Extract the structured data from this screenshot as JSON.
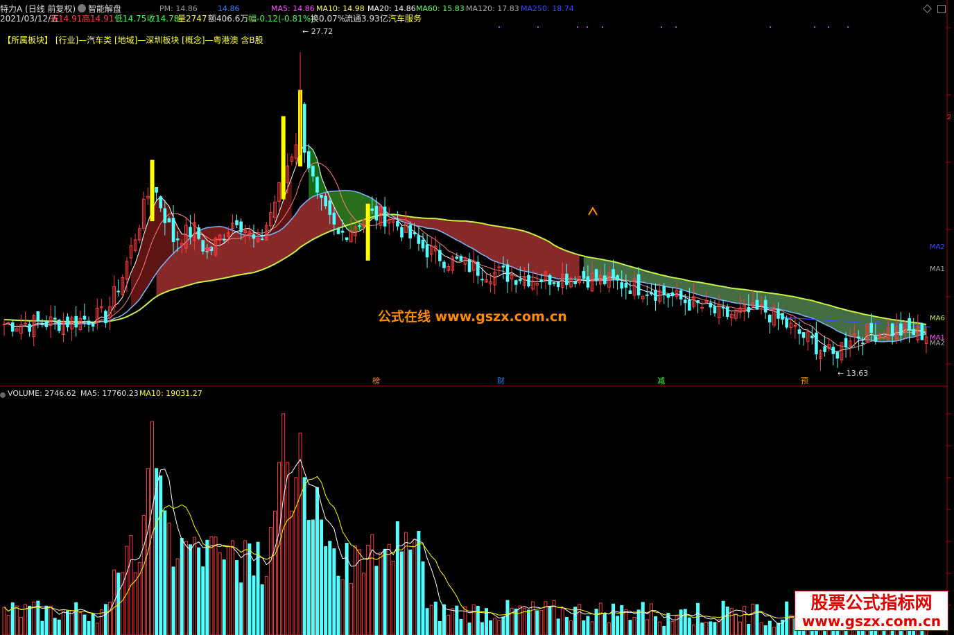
{
  "header": {
    "stock_title": "特力A (日线 前复权)",
    "mode_label": "智能解盘",
    "pm_label": "PM: 14.86",
    "pm_value": "14.86",
    "ma5": "MA5: 14.86",
    "ma10": "MA10: 14.98",
    "ma20": "MA20: 14.86",
    "ma60": "MA60: 15.83",
    "ma120": "MA120: 17.83",
    "ma250": "MA250: 18.74",
    "date": "2021/03/12/五",
    "open": "开14.91",
    "high": "高14.91",
    "low": "低14.75",
    "close": "收14.78",
    "vol": "量2747",
    "amount": "额406.6万",
    "change": "幅-0.12(-0.81%)",
    "turnover": "换0.07%",
    "float_cap": "流通3.93亿",
    "industry": "汽车服务",
    "sector_line": "【所属板块】 [行业]—汽车类 [地域]—深圳板块 [概念]—粤港澳 含B股"
  },
  "annotations": {
    "high_label": "27.72",
    "low_label": "13.63",
    "watermark_center": "公式在线  www.gszx.com.cn",
    "markers": [
      "榜",
      "财",
      "减",
      "预"
    ],
    "right_labels": [
      "MA2",
      "MA1",
      "MA6",
      "MA1",
      "MA2"
    ],
    "right_tick": "2"
  },
  "volume_header": {
    "label": "VOLUME: 2746.62",
    "ma5": "MA5: 17760.23",
    "ma10": "MA10: 19031.27"
  },
  "watermark_corner": {
    "line1": "股票公式指标网",
    "line2": "www.gszx.com.cn"
  },
  "colors": {
    "up": "#ff3c3c",
    "down": "#54ffff",
    "ma5": "#ffffff",
    "ma10": "#ffff00",
    "ma20": "#7ab8ff",
    "ma60": "#c8f046",
    "ma250": "#3050ff",
    "red_fill": "#a03030",
    "green_fill": "#508050",
    "accent": "#ff9000"
  },
  "chart_data": {
    "type": "candlestick",
    "price_range": [
      13.0,
      29.0
    ],
    "volume_range": [
      0,
      60000
    ],
    "price_anchors": [
      {
        "i": 0,
        "p": 15.3
      },
      {
        "i": 15,
        "p": 15.4
      },
      {
        "i": 24,
        "p": 15.7
      },
      {
        "i": 28,
        "p": 17.5
      },
      {
        "i": 35,
        "p": 21.8
      },
      {
        "i": 40,
        "p": 19.2
      },
      {
        "i": 45,
        "p": 19.6
      },
      {
        "i": 48,
        "p": 18.5
      },
      {
        "i": 55,
        "p": 20.2
      },
      {
        "i": 60,
        "p": 18.8
      },
      {
        "i": 66,
        "p": 22.0
      },
      {
        "i": 70,
        "p": 24.3
      },
      {
        "i": 74,
        "p": 21.0
      },
      {
        "i": 79,
        "p": 19.3
      },
      {
        "i": 86,
        "p": 20.3
      },
      {
        "i": 91,
        "p": 20.2
      },
      {
        "i": 98,
        "p": 18.9
      },
      {
        "i": 104,
        "p": 18.3
      },
      {
        "i": 114,
        "p": 17.7
      },
      {
        "i": 125,
        "p": 17.4
      },
      {
        "i": 136,
        "p": 17.5
      },
      {
        "i": 150,
        "p": 17.0
      },
      {
        "i": 156,
        "p": 16.7
      },
      {
        "i": 170,
        "p": 15.7
      },
      {
        "i": 180,
        "p": 15.9
      },
      {
        "i": 190,
        "p": 14.6
      },
      {
        "i": 196,
        "p": 13.8
      },
      {
        "i": 200,
        "p": 14.8
      },
      {
        "i": 210,
        "p": 15.0
      },
      {
        "i": 218,
        "p": 14.85
      }
    ],
    "volume_peaks": [
      {
        "i": 35,
        "v": 55000
      },
      {
        "i": 66,
        "v": 57000
      },
      {
        "i": 70,
        "v": 52000
      },
      {
        "i": 37,
        "v": 41000
      },
      {
        "i": 74,
        "v": 38000
      },
      {
        "i": 92,
        "v": 19000
      }
    ],
    "ma250_level": 15.6,
    "ma60_right_label": "MA6",
    "high_point": {
      "i": 70,
      "p": 27.72
    },
    "low_point": {
      "i": 197,
      "p": 13.63
    }
  }
}
